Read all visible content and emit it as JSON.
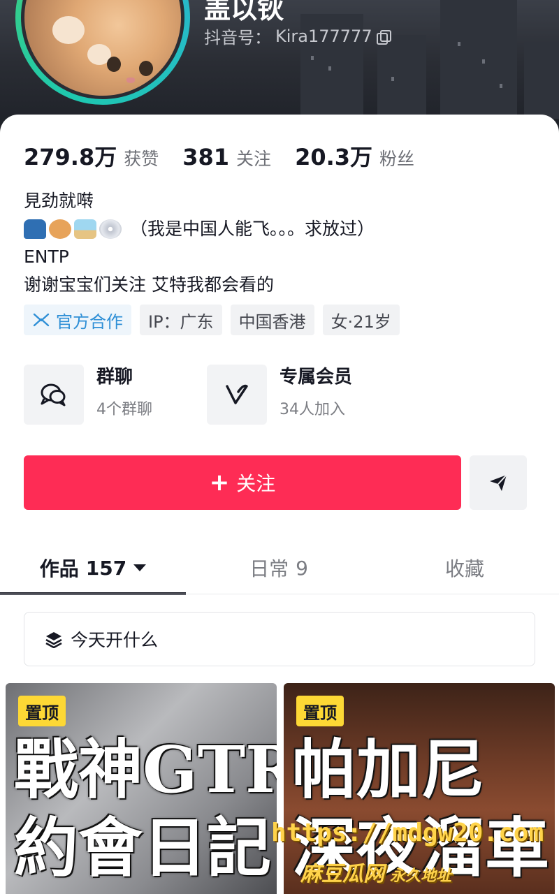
{
  "profile": {
    "username": "盖以钬",
    "douyin_id_label": "抖音号：",
    "douyin_id": "Kira177777"
  },
  "stats": [
    {
      "value": "279.8万",
      "label": "获赞"
    },
    {
      "value": "381",
      "label": "关注"
    },
    {
      "value": "20.3万",
      "label": "粉丝"
    }
  ],
  "bio": {
    "line1": "見劲就啭",
    "line2_emojis": [
      "car-emoji",
      "cat-emoji",
      "island-emoji",
      "disc-emoji"
    ],
    "line2_text": "（我是中国人能飞。。。求放过）",
    "line3": "ENTP",
    "line4": "谢谢宝宝们关注 艾特我都会看的"
  },
  "tags": [
    {
      "label": "官方合作",
      "icon": "official-partner-icon"
    },
    {
      "label": "IP：广东"
    },
    {
      "label": "中国香港"
    },
    {
      "label": "女·21岁"
    }
  ],
  "services": [
    {
      "title": "群聊",
      "subtitle": "4个群聊",
      "icon": "group-chat-icon"
    },
    {
      "title": "专属会员",
      "subtitle": "34人加入",
      "icon": "membership-icon"
    }
  ],
  "actions": {
    "follow_plus": "+",
    "follow_label": "关注",
    "share_icon": "send-icon"
  },
  "tabs": [
    {
      "label": "作品",
      "count": "157",
      "active": true
    },
    {
      "label": "日常",
      "count": "9",
      "active": false
    },
    {
      "label": "收藏",
      "count": "",
      "active": false
    }
  ],
  "playlist": {
    "label": "今天开什么",
    "icon": "stack-icon"
  },
  "videos": [
    {
      "badge": "置顶",
      "title_line1": "戰神GTR",
      "title_line2": "約會日記"
    },
    {
      "badge": "置顶",
      "title_line1": "帕加尼",
      "title_line2": "深夜溜車"
    }
  ],
  "watermark": {
    "url": "https://mdgw20.com",
    "brand": "麻豆瓜网",
    "suffix": "永久地址"
  },
  "colors": {
    "accent": "#fe2c55",
    "badge": "#fdd835",
    "official": "#2e8fd6",
    "avatar_ring": "#3fd07a"
  }
}
